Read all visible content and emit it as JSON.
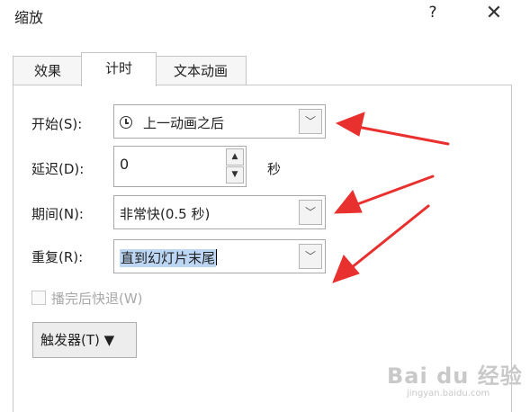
{
  "dialog": {
    "title": "缩放",
    "help_label": "?",
    "close_label": "✕"
  },
  "tabs": [
    {
      "label": "效果",
      "active": false
    },
    {
      "label": "计时",
      "active": true
    },
    {
      "label": "文本动画",
      "active": false
    }
  ],
  "timing": {
    "start_label": "开始(S):",
    "start_value": "上一动画之后",
    "delay_label": "延迟(D):",
    "delay_value": "0",
    "delay_unit": "秒",
    "duration_label": "期间(N):",
    "duration_value": "非常快(0.5 秒)",
    "repeat_label": "重复(R):",
    "repeat_value": "直到幻灯片末尾",
    "rewind_label": "播完后快退(W)",
    "rewind_checked": false,
    "trigger_label": "触发器(T) ▼"
  },
  "watermark": {
    "brand": "Bai du 经验",
    "url": "jingyan.baidu.com"
  },
  "colors": {
    "arrow_red": "#e8302f",
    "selection_blue": "#bcd6f4"
  }
}
